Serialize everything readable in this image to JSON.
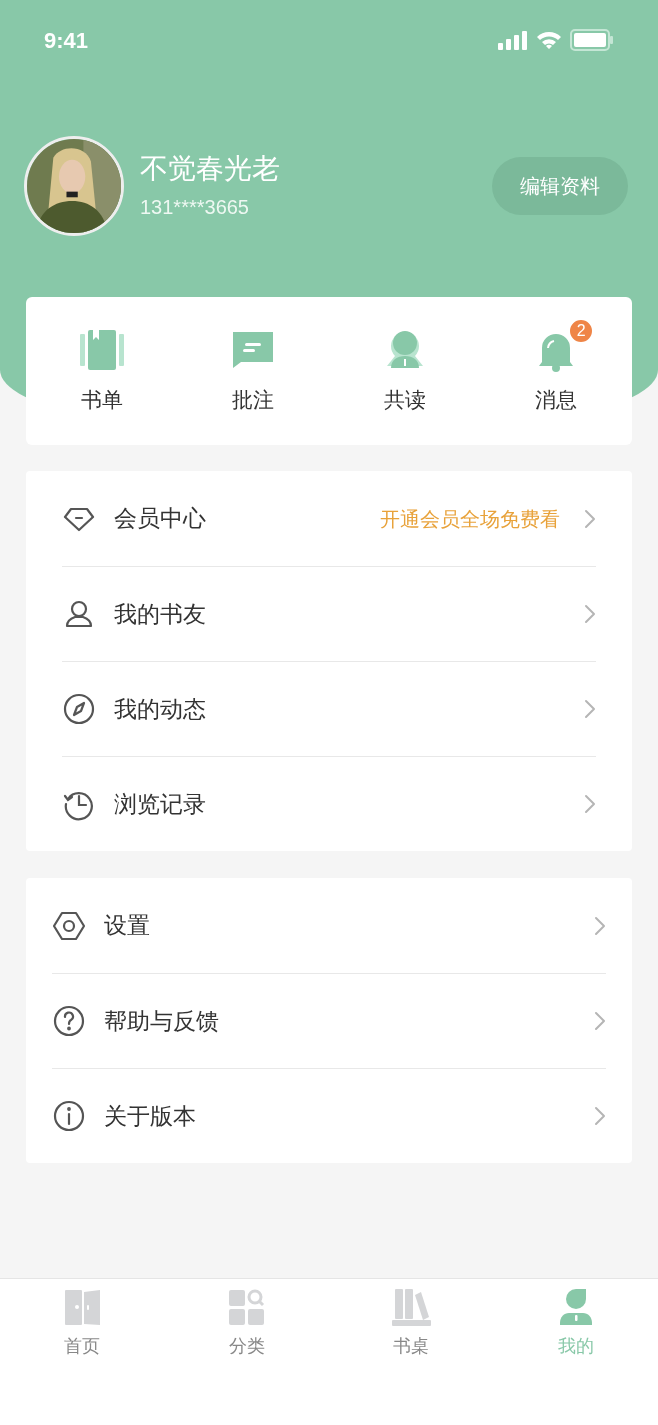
{
  "status_bar": {
    "time": "9:41"
  },
  "profile": {
    "name": "不觉春光老",
    "phone": "131****3665",
    "edit_button": "编辑资料"
  },
  "shortcuts": [
    {
      "kind": "booklist",
      "label": "书单"
    },
    {
      "kind": "notes",
      "label": "批注"
    },
    {
      "kind": "coread",
      "label": "共读"
    },
    {
      "kind": "messages",
      "label": "消息",
      "badge": "2"
    }
  ],
  "menu_groups": [
    [
      {
        "kind": "diamond",
        "label": "会员中心",
        "hint": "开通会员全场免费看"
      },
      {
        "kind": "person",
        "label": "我的书友"
      },
      {
        "kind": "compass",
        "label": "我的动态"
      },
      {
        "kind": "history",
        "label": "浏览记录"
      }
    ],
    [
      {
        "kind": "hexagon",
        "label": "设置"
      },
      {
        "kind": "help",
        "label": "帮助与反馈"
      },
      {
        "kind": "info",
        "label": "关于版本"
      }
    ]
  ],
  "tab_bar": [
    {
      "kind": "home",
      "label": "首页",
      "selected": false
    },
    {
      "kind": "category",
      "label": "分类",
      "selected": false
    },
    {
      "kind": "desk",
      "label": "书桌",
      "selected": false
    },
    {
      "kind": "me",
      "label": "我的",
      "selected": true
    }
  ]
}
